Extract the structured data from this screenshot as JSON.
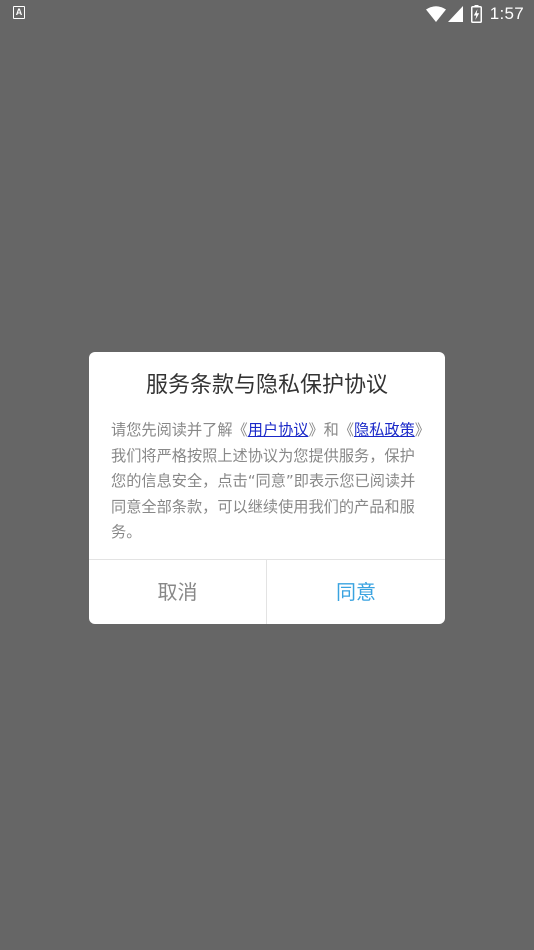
{
  "status_bar": {
    "notification_icon": "A",
    "time": "1:57",
    "icons": [
      "wifi-icon",
      "signal-icon",
      "battery-charging-icon"
    ]
  },
  "dialog": {
    "title": "服务条款与隐私保护协议",
    "body_prefix": "请您先阅读并了解《",
    "user_agreement_link": "用户协议",
    "body_middle": "》和《",
    "privacy_policy_link": "隐私政策",
    "body_suffix": "》我们将严格按照上述协议为您提供服务，保护您的信息安全，点击“同意”即表示您已阅读并同意全部条款，可以继续使用我们的产品和服务。",
    "cancel_label": "取消",
    "agree_label": "同意"
  },
  "colors": {
    "overlay": "#666666",
    "link": "#1a28c8",
    "agree": "#3aa3e0",
    "text_muted": "#888888"
  }
}
